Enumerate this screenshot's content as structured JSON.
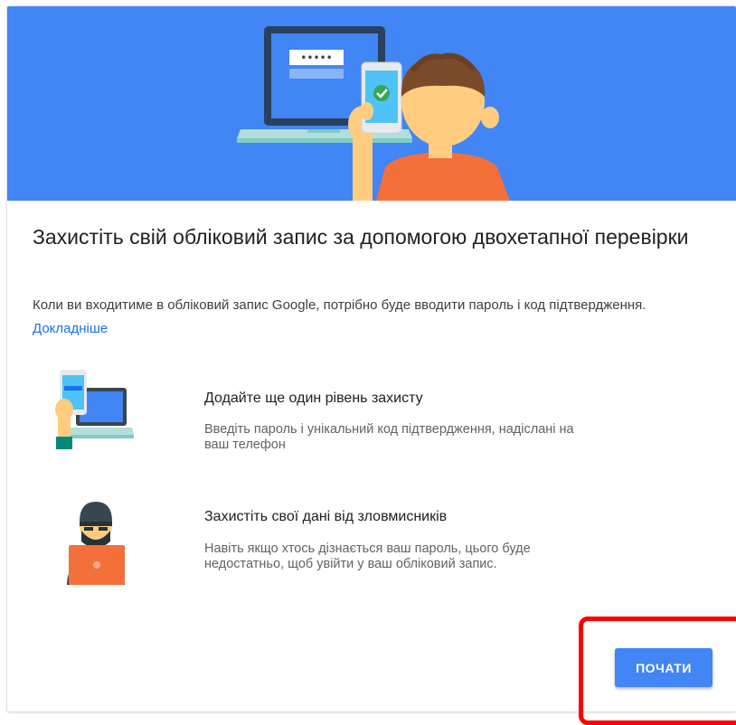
{
  "heading": "Захистіть свій обліковий запис за допомогою двохетапної перевірки",
  "description": {
    "text": "Коли ви входитиме в обліковий запис Google, потрібно буде вводити пароль і код підтвердження. ",
    "link": "Докладніше"
  },
  "hero": {
    "password_mask": "•••••",
    "icon": "person-laptop-phone-illustration",
    "accent_color": "#4285f4"
  },
  "features": [
    {
      "icon": "phone-laptop-icon",
      "title": "Додайте ще один рівень захисту",
      "text": "Введіть пароль і унікальний код підтвердження, надіслані на ваш телефон"
    },
    {
      "icon": "hacker-icon",
      "title": "Захистіть свої дані від зловмисників",
      "text": "Навіть якщо хтось дізнається ваш пароль, цього буде недостатньо, щоб увійти у ваш обліковий запис."
    }
  ],
  "start_button": "ПОЧАТИ",
  "highlight_color": "#ff0000"
}
